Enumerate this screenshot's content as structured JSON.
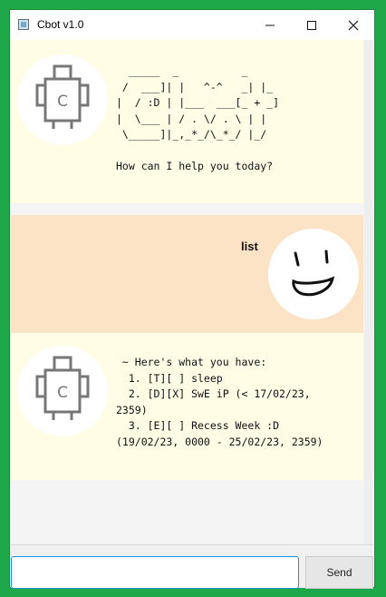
{
  "window": {
    "title": "Cbot v1.0",
    "controls": {
      "minimize": "—",
      "maximize": "☐",
      "close": "✕"
    }
  },
  "dialogs": [
    {
      "speaker": "bot",
      "avatar": "robot-icon",
      "text": "  _____  _          _\n /  ___]| |   ^-^   _| |_\n|  / :D | |___  ___[_ + _]\n|  \\___ | / . \\/ . \\ | |\n \\_____]|_,_*_/\\_*_/ |_/\n\nHow can I help you today?"
    },
    {
      "speaker": "user",
      "avatar": "smiley-face-icon",
      "text": "list"
    },
    {
      "speaker": "bot",
      "avatar": "robot-icon",
      "text": " ~ Here's what you have:\n  1. [T][ ] sleep\n  2. [D][X] SwE iP (< 17/02/23,\n2359)\n  3. [E][ ] Recess Week :D\n(19/02/23, 0000 - 25/02/23, 2359)"
    }
  ],
  "input": {
    "value": "",
    "placeholder": ""
  },
  "send_button": {
    "label": "Send"
  },
  "colors": {
    "background": "#1fa84a",
    "bot_bubble": "#fffde6",
    "user_bubble": "#fde3c6",
    "input_focus": "#1e90d6"
  }
}
